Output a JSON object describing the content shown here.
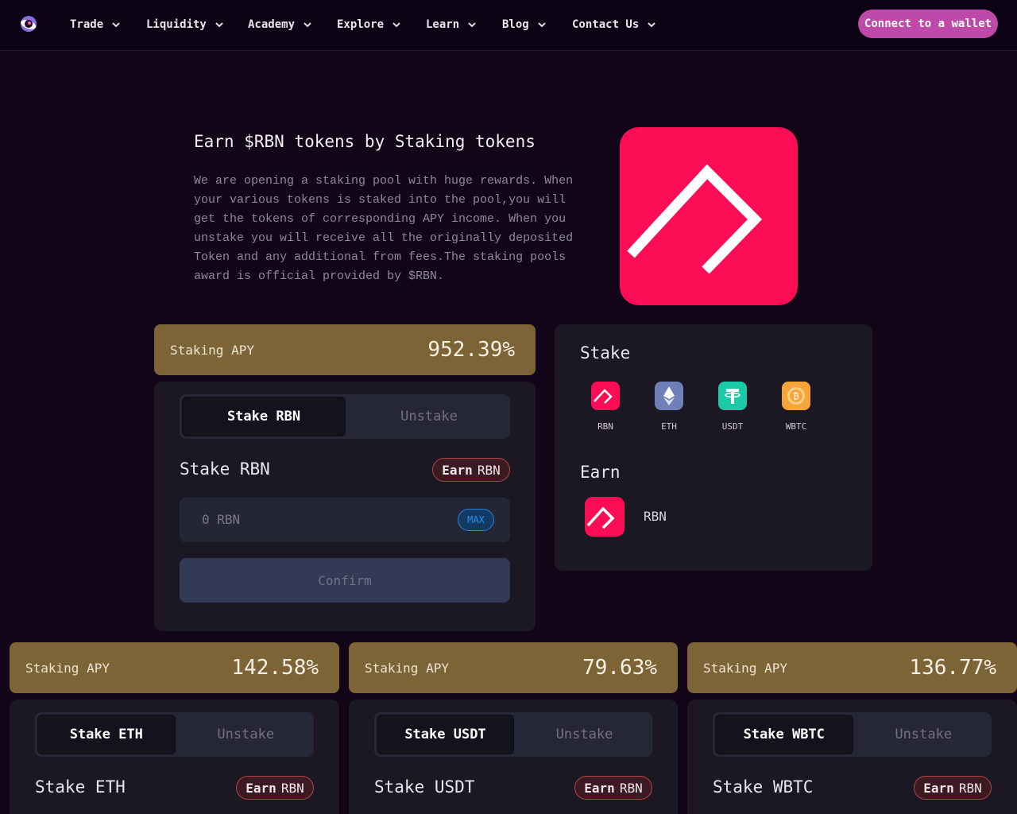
{
  "nav": {
    "items": [
      "Trade",
      "Liquidity",
      "Academy",
      "Explore",
      "Learn",
      "Blog",
      "Contact Us"
    ],
    "connect_label": "Connect to a wallet"
  },
  "hero": {
    "title": "Earn $RBN tokens by Staking tokens",
    "description": "We are opening a staking pool with huge rewards. When your various tokens is staked into the pool,you will get the tokens of corresponding APY income. When you unstake you will receive all the originally deposited Token and any additional from fees.The staking pools award is official provided by $RBN."
  },
  "pools": [
    {
      "apy_label": "Staking APY",
      "apy": "952.39%",
      "stake_tab": "Stake RBN",
      "unstake_tab": "Unstake",
      "heading": "Stake RBN",
      "earn_bold": "Earn",
      "earn_token": "RBN",
      "amount": "0 RBN",
      "max_label": "MAX",
      "confirm_label": "Confirm"
    },
    {
      "apy_label": "Staking APY",
      "apy": "142.58%",
      "stake_tab": "Stake ETH",
      "unstake_tab": "Unstake",
      "heading": "Stake ETH",
      "earn_bold": "Earn",
      "earn_token": "RBN"
    },
    {
      "apy_label": "Staking APY",
      "apy": "79.63%",
      "stake_tab": "Stake USDT",
      "unstake_tab": "Unstake",
      "heading": "Stake USDT",
      "earn_bold": "Earn",
      "earn_token": "RBN"
    },
    {
      "apy_label": "Staking APY",
      "apy": "136.77%",
      "stake_tab": "Stake WBTC",
      "unstake_tab": "Unstake",
      "heading": "Stake WBTC",
      "earn_bold": "Earn",
      "earn_token": "RBN"
    }
  ],
  "panel": {
    "stake_heading": "Stake",
    "tokens": [
      "RBN",
      "ETH",
      "USDT",
      "WBTC"
    ],
    "earn_heading": "Earn",
    "earn_token": "RBN"
  },
  "colors": {
    "background": "#120518",
    "accent": "#bf49a8",
    "brand": "#fe0d57",
    "apy_bar": "#7d6436",
    "card": "#1b1824"
  }
}
